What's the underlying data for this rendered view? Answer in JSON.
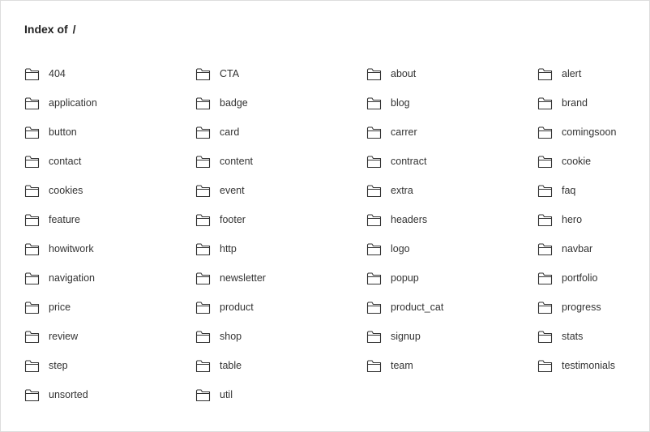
{
  "header": {
    "title": "Index of",
    "path": "/"
  },
  "entries": [
    {
      "name": "404",
      "icon": "folder-icon"
    },
    {
      "name": "CTA",
      "icon": "folder-icon"
    },
    {
      "name": "about",
      "icon": "folder-icon"
    },
    {
      "name": "alert",
      "icon": "folder-icon"
    },
    {
      "name": "application",
      "icon": "folder-icon"
    },
    {
      "name": "badge",
      "icon": "folder-icon"
    },
    {
      "name": "blog",
      "icon": "folder-icon"
    },
    {
      "name": "brand",
      "icon": "folder-icon"
    },
    {
      "name": "button",
      "icon": "folder-icon"
    },
    {
      "name": "card",
      "icon": "folder-icon"
    },
    {
      "name": "carrer",
      "icon": "folder-icon"
    },
    {
      "name": "comingsoon",
      "icon": "folder-icon"
    },
    {
      "name": "contact",
      "icon": "folder-icon"
    },
    {
      "name": "content",
      "icon": "folder-icon"
    },
    {
      "name": "contract",
      "icon": "folder-icon"
    },
    {
      "name": "cookie",
      "icon": "folder-icon"
    },
    {
      "name": "cookies",
      "icon": "folder-icon"
    },
    {
      "name": "event",
      "icon": "folder-icon"
    },
    {
      "name": "extra",
      "icon": "folder-icon"
    },
    {
      "name": "faq",
      "icon": "folder-icon"
    },
    {
      "name": "feature",
      "icon": "folder-icon"
    },
    {
      "name": "footer",
      "icon": "folder-icon"
    },
    {
      "name": "headers",
      "icon": "folder-icon"
    },
    {
      "name": "hero",
      "icon": "folder-icon"
    },
    {
      "name": "howitwork",
      "icon": "folder-icon"
    },
    {
      "name": "http",
      "icon": "folder-icon"
    },
    {
      "name": "logo",
      "icon": "folder-icon"
    },
    {
      "name": "navbar",
      "icon": "folder-icon"
    },
    {
      "name": "navigation",
      "icon": "folder-icon"
    },
    {
      "name": "newsletter",
      "icon": "folder-icon"
    },
    {
      "name": "popup",
      "icon": "folder-icon"
    },
    {
      "name": "portfolio",
      "icon": "folder-icon"
    },
    {
      "name": "price",
      "icon": "folder-icon"
    },
    {
      "name": "product",
      "icon": "folder-icon"
    },
    {
      "name": "product_cat",
      "icon": "folder-icon"
    },
    {
      "name": "progress",
      "icon": "folder-icon"
    },
    {
      "name": "review",
      "icon": "folder-icon"
    },
    {
      "name": "shop",
      "icon": "folder-icon"
    },
    {
      "name": "signup",
      "icon": "folder-icon"
    },
    {
      "name": "stats",
      "icon": "folder-icon"
    },
    {
      "name": "step",
      "icon": "folder-icon"
    },
    {
      "name": "table",
      "icon": "folder-icon"
    },
    {
      "name": "team",
      "icon": "folder-icon"
    },
    {
      "name": "testimonials",
      "icon": "folder-icon"
    },
    {
      "name": "unsorted",
      "icon": "folder-icon"
    },
    {
      "name": "util",
      "icon": "folder-icon"
    }
  ],
  "colors": {
    "text": "#333333",
    "icon_stroke": "#333333",
    "border": "#dddddd"
  }
}
